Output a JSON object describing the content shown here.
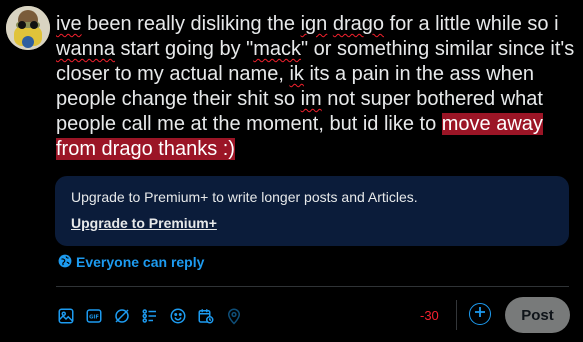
{
  "post": {
    "text_parts": [
      {
        "text": "ive",
        "style": "sq"
      },
      {
        "text": " been really disliking the ",
        "style": ""
      },
      {
        "text": "ign",
        "style": "sq"
      },
      {
        "text": " ",
        "style": ""
      },
      {
        "text": "drago",
        "style": "sq"
      },
      {
        "text": " for a little while so i ",
        "style": ""
      },
      {
        "text": "wanna",
        "style": "sq"
      },
      {
        "text": " start going by \"",
        "style": ""
      },
      {
        "text": "mack",
        "style": "sq"
      },
      {
        "text": "\" or something similar since it's closer to my actual name, ",
        "style": ""
      },
      {
        "text": "ik",
        "style": "sq"
      },
      {
        "text": " its a pain in the ass when people change their shit so ",
        "style": ""
      },
      {
        "text": "im",
        "style": "sq"
      },
      {
        "text": " not super bothered what people call me at the moment, but id like to ",
        "style": ""
      },
      {
        "text": "move away from drago thanks :)",
        "style": "overflow"
      }
    ]
  },
  "premium": {
    "message": "Upgrade to Premium+ to write longer posts and Articles.",
    "link_label": "Upgrade to Premium+"
  },
  "reply_setting": {
    "label": "Everyone can reply"
  },
  "toolbar": {
    "icons": [
      "image-icon",
      "gif-icon",
      "grok-icon",
      "poll-icon",
      "emoji-icon",
      "schedule-icon",
      "location-icon"
    ],
    "char_counter": "-30",
    "post_label": "Post"
  },
  "colors": {
    "accent": "#1d9bf0",
    "overflow_highlight": "#9b1526",
    "premium_box": "#0b1c3a",
    "error": "#f4212e"
  }
}
